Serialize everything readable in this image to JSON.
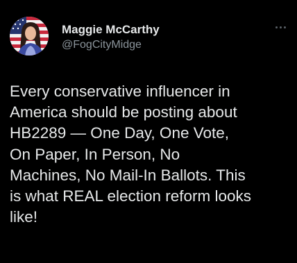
{
  "user": {
    "display_name": "Maggie McCarthy",
    "handle": "@FogCityMidge"
  },
  "menu": {
    "icon": "more-horizontal-icon"
  },
  "post": {
    "lines": [
      "Every conservative influencer in",
      "America should be posting about",
      "HB2289 — One Day, One Vote,",
      "On Paper, In Person, No",
      "Machines, No Mail-In Ballots. This",
      "is what REAL election reform looks",
      "like!"
    ]
  },
  "colors": {
    "background": "#000000",
    "primary_text": "#e7e9ea",
    "secondary_text": "#8b949b"
  }
}
